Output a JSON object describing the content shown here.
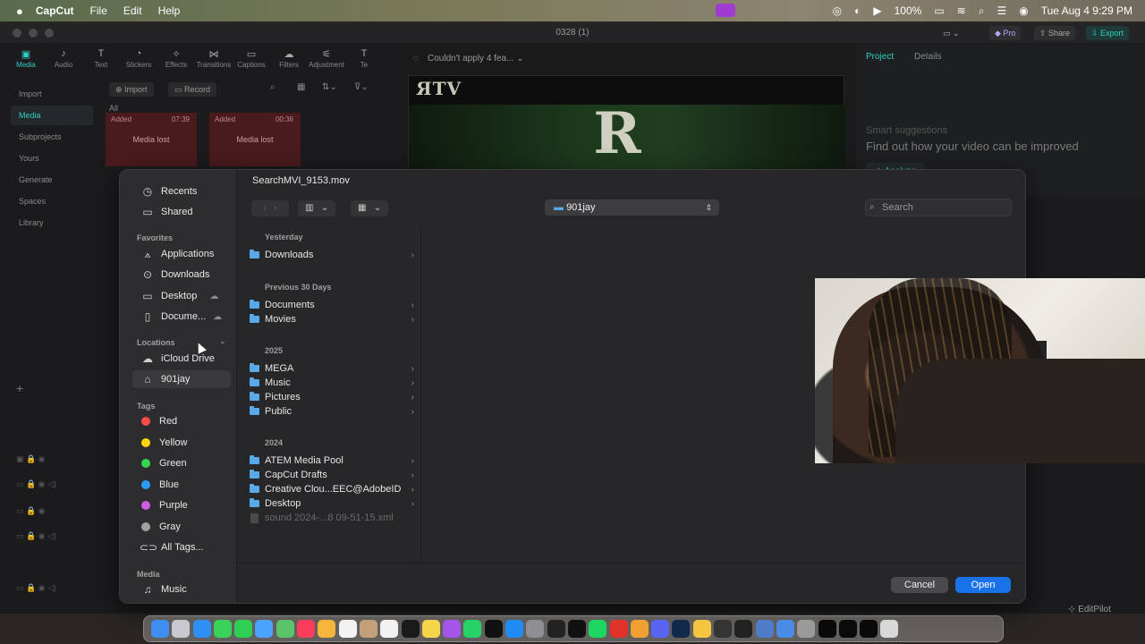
{
  "menubar": {
    "app": "CapCut",
    "items": [
      "File",
      "Edit",
      "Help"
    ],
    "battery": "100%",
    "clock": "Tue Aug 4  9:29 PM"
  },
  "window": {
    "title": "0328 (1)",
    "pro": "Pro",
    "share": "Share",
    "export": "Export"
  },
  "toolstrip": [
    {
      "label": "Media",
      "glyph": "▣"
    },
    {
      "label": "Audio",
      "glyph": "♪"
    },
    {
      "label": "Text",
      "glyph": "T"
    },
    {
      "label": "Stickers",
      "glyph": "◔"
    },
    {
      "label": "Effects",
      "glyph": "✧"
    },
    {
      "label": "Transitions",
      "glyph": "⋈"
    },
    {
      "label": "Captions",
      "glyph": "▭"
    },
    {
      "label": "Filters",
      "glyph": "☁"
    },
    {
      "label": "Adjustment",
      "glyph": "⚟"
    },
    {
      "label": "Te",
      "glyph": "T"
    }
  ],
  "leftnav": [
    "Import",
    "Media",
    "Subprojects",
    "Yours",
    "Generate",
    "Spaces",
    "Library"
  ],
  "media": {
    "import_btn": "Import",
    "record_btn": "Record",
    "all_label": "All",
    "clips": [
      {
        "added": "Added",
        "duration": "07:39",
        "status": "Media lost"
      },
      {
        "added": "Added",
        "duration": "00:36",
        "status": "Media lost"
      }
    ]
  },
  "preview": {
    "status": "Couldn't apply 4 fea...",
    "logo_text": "ЯTV",
    "logo_glyph": "R"
  },
  "rightpanel": {
    "tab_project": "Project",
    "tab_details": "Details",
    "smart_title": "Smart suggestions",
    "smart_text": "Find out how your video can be improved",
    "analyze": "Analyze"
  },
  "dialog": {
    "title": "SearchMVI_9153.mov",
    "current_folder": "901jay",
    "search_placeholder": "Search",
    "sidebar": {
      "recents": "Recents",
      "shared": "Shared",
      "favorites_head": "Favorites",
      "favorites": [
        "Applications",
        "Downloads",
        "Desktop",
        "Docume..."
      ],
      "locations_head": "Locations",
      "locations": [
        "iCloud Drive",
        "901jay"
      ],
      "tags_head": "Tags",
      "tags": [
        {
          "name": "Red",
          "color": "#ff4b4b"
        },
        {
          "name": "Yellow",
          "color": "#ffd60a"
        },
        {
          "name": "Green",
          "color": "#32d74b"
        },
        {
          "name": "Blue",
          "color": "#2b9cff"
        },
        {
          "name": "Purple",
          "color": "#d05ce3"
        },
        {
          "name": "Gray",
          "color": "#a0a0a0"
        }
      ],
      "all_tags": "All Tags...",
      "media_head": "Media",
      "media": [
        "Music"
      ]
    },
    "groups": [
      {
        "head": "Yesterday",
        "items": [
          "Downloads"
        ]
      },
      {
        "head": "Previous 30 Days",
        "items": [
          "Documents",
          "Movies"
        ]
      },
      {
        "head": "2025",
        "items": [
          "MEGA",
          "Music",
          "Pictures",
          "Public"
        ]
      },
      {
        "head": "2024",
        "items": [
          "ATEM Media Pool",
          "CapCut Drafts",
          "Creative Clou...EEC@AdobeID",
          "Desktop"
        ]
      }
    ],
    "dim_file": "sound 2024-...8 09-51-15.xml",
    "cancel": "Cancel",
    "open": "Open"
  },
  "editpilot": "EditPilot",
  "dock_apps": [
    {
      "name": "finder-icon",
      "color": "#3d8ef0"
    },
    {
      "name": "launchpad-icon",
      "color": "#c8c8d0"
    },
    {
      "name": "safari-icon",
      "color": "#2f8ff5"
    },
    {
      "name": "messages-icon",
      "color": "#39d159"
    },
    {
      "name": "facetime-icon",
      "color": "#2fcf53"
    },
    {
      "name": "mail-icon",
      "color": "#4aa3ff"
    },
    {
      "name": "maps-icon",
      "color": "#5bc36b"
    },
    {
      "name": "music-icon",
      "color": "#fb3d5b"
    },
    {
      "name": "photos-icon",
      "color": "#f4b53a"
    },
    {
      "name": "calendar-icon",
      "color": "#f2f2f2"
    },
    {
      "name": "contacts-icon",
      "color": "#c4a07a"
    },
    {
      "name": "reminders-icon",
      "color": "#f2f2f2"
    },
    {
      "name": "tv-icon",
      "color": "#1a1a1a"
    },
    {
      "name": "notes-icon",
      "color": "#f7d54a"
    },
    {
      "name": "podcasts-icon",
      "color": "#a356e8"
    },
    {
      "name": "whatsapp-icon",
      "color": "#25d366"
    },
    {
      "name": "tiktok-icon",
      "color": "#111111"
    },
    {
      "name": "appstore-icon",
      "color": "#1f8cf5"
    },
    {
      "name": "settings-icon",
      "color": "#8e8e93"
    },
    {
      "name": "chatgpt-icon",
      "color": "#222222"
    },
    {
      "name": "capcut-icon",
      "color": "#111111"
    },
    {
      "name": "spotify-icon",
      "color": "#1ed760"
    },
    {
      "name": "record-icon",
      "color": "#e0342a"
    },
    {
      "name": "pencil-icon",
      "color": "#f0a030"
    },
    {
      "name": "discord-icon",
      "color": "#5865f2"
    },
    {
      "name": "photoshop-icon",
      "color": "#0f2a4a"
    },
    {
      "name": "yellow-dot-icon",
      "color": "#f5c542"
    },
    {
      "name": "video-icon",
      "color": "#333333"
    },
    {
      "name": "terminal-icon",
      "color": "#222222"
    },
    {
      "name": "preview-icon",
      "color": "#4f7cc8"
    },
    {
      "name": "files-icon",
      "color": "#4a8be6"
    },
    {
      "name": "app-icon",
      "color": "#9a9a9a"
    },
    {
      "name": "window-thumb-icon",
      "color": "#0a0a0a"
    },
    {
      "name": "window-thumb-icon",
      "color": "#0a0a0a"
    },
    {
      "name": "window-thumb-icon",
      "color": "#0a0a0a"
    },
    {
      "name": "trash-icon",
      "color": "#d8d8d8"
    }
  ]
}
